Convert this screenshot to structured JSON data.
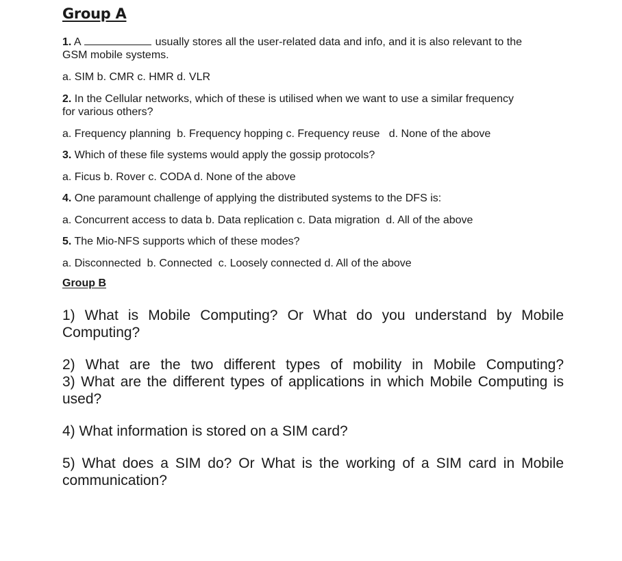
{
  "group_a": {
    "heading": "Group A",
    "q1": {
      "number": "1.",
      "text_start": "A",
      "text_end": "usually stores all the user-related data and info, and it is also relevant to the",
      "text_cont": "GSM mobile systems.",
      "options": "a. SIM b. CMR c. HMR d. VLR"
    },
    "q2": {
      "number": "2.",
      "line1": "In the Cellular networks, which of these is utilised when we want to use a similar frequency",
      "line2": "for various others?",
      "options": "a. Frequency planning  b. Frequency hopping c. Frequency reuse   d. None of the above"
    },
    "q3": {
      "number": "3.",
      "text": "Which of these file systems would apply the gossip protocols?",
      "options": "a. Ficus b. Rover c. CODA d. None of the above"
    },
    "q4": {
      "number": "4.",
      "text": "One paramount challenge of applying the distributed systems to the DFS is:",
      "options": "a. Concurrent access to data b. Data replication c. Data migration  d. All of the above"
    },
    "q5": {
      "number": "5.",
      "text": "The Mio-NFS supports which of these modes?",
      "options": "a. Disconnected  b. Connected  c. Loosely connected d. All of the above"
    }
  },
  "group_b": {
    "heading": "Group B",
    "q1_line1": "1) What is Mobile Computing? Or What do you understand by Mobile",
    "q1_line2": "Computing?",
    "q2_line1": "2) What are the two different types of mobility in Mobile Computing?",
    "q3_line1": "3) What are the different types of applications in which Mobile Computing is",
    "q3_line2": "used?",
    "q4_line1": "4) What information is stored on a SIM card?",
    "q5_line1": "5) What does a SIM do? Or What is the working of a SIM card in Mobile",
    "q5_line2": "communication?"
  }
}
